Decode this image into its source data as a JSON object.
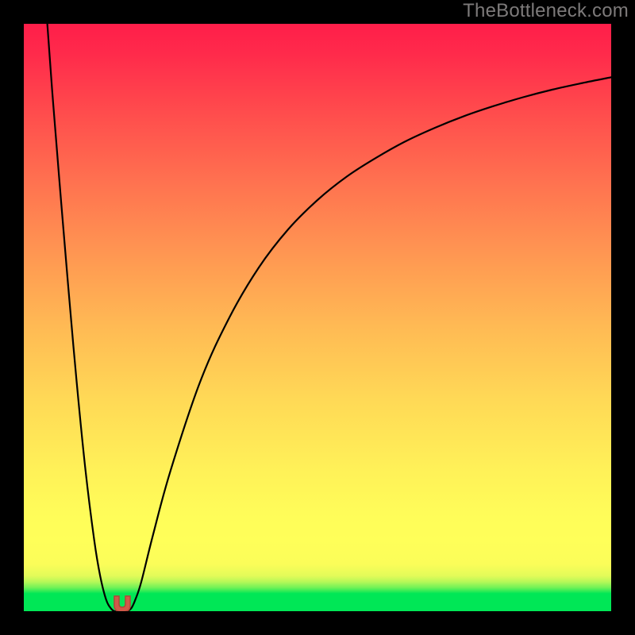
{
  "watermark": {
    "text": "TheBottleneck.com"
  },
  "chart_data": {
    "type": "line",
    "title": "",
    "xlabel": "",
    "ylabel": "",
    "xlim": [
      0,
      100
    ],
    "ylim": [
      0,
      100
    ],
    "legend": false,
    "grid": false,
    "background_gradient": {
      "direction": "vertical",
      "stops": [
        {
          "pct": 0,
          "color": "#00e756"
        },
        {
          "pct": 8,
          "color": "#fbfd59"
        },
        {
          "pct": 100,
          "color": "#ff1e4a"
        }
      ]
    },
    "series": [
      {
        "name": "left-branch",
        "x": [
          4.0,
          4.8,
          6.0,
          7.5,
          9.0,
          10.5,
          12.0,
          13.0,
          14.0,
          14.8,
          15.4,
          16.0
        ],
        "y": [
          100,
          89.0,
          74.0,
          56.0,
          39.0,
          24.0,
          12.0,
          6.0,
          2.0,
          0.5,
          0.0,
          0.0
        ]
      },
      {
        "name": "right-branch",
        "x": [
          17.6,
          18.3,
          19.0,
          20.0,
          22.0,
          25.0,
          30.0,
          35.0,
          40.0,
          45.0,
          50.0,
          55.0,
          60.0,
          65.0,
          70.0,
          75.0,
          80.0,
          85.0,
          90.0,
          95.0,
          100.0
        ],
        "y": [
          0.0,
          0.5,
          2.0,
          5.0,
          13.0,
          24.0,
          39.0,
          50.0,
          58.5,
          65.0,
          70.0,
          74.0,
          77.2,
          80.0,
          82.3,
          84.3,
          86.0,
          87.5,
          88.8,
          89.9,
          90.9
        ]
      }
    ],
    "marker": {
      "x": 16.8,
      "y": 1.2,
      "color": "#cf5a4a",
      "outline": "#b54538",
      "shape": "u-shaped-token"
    }
  }
}
